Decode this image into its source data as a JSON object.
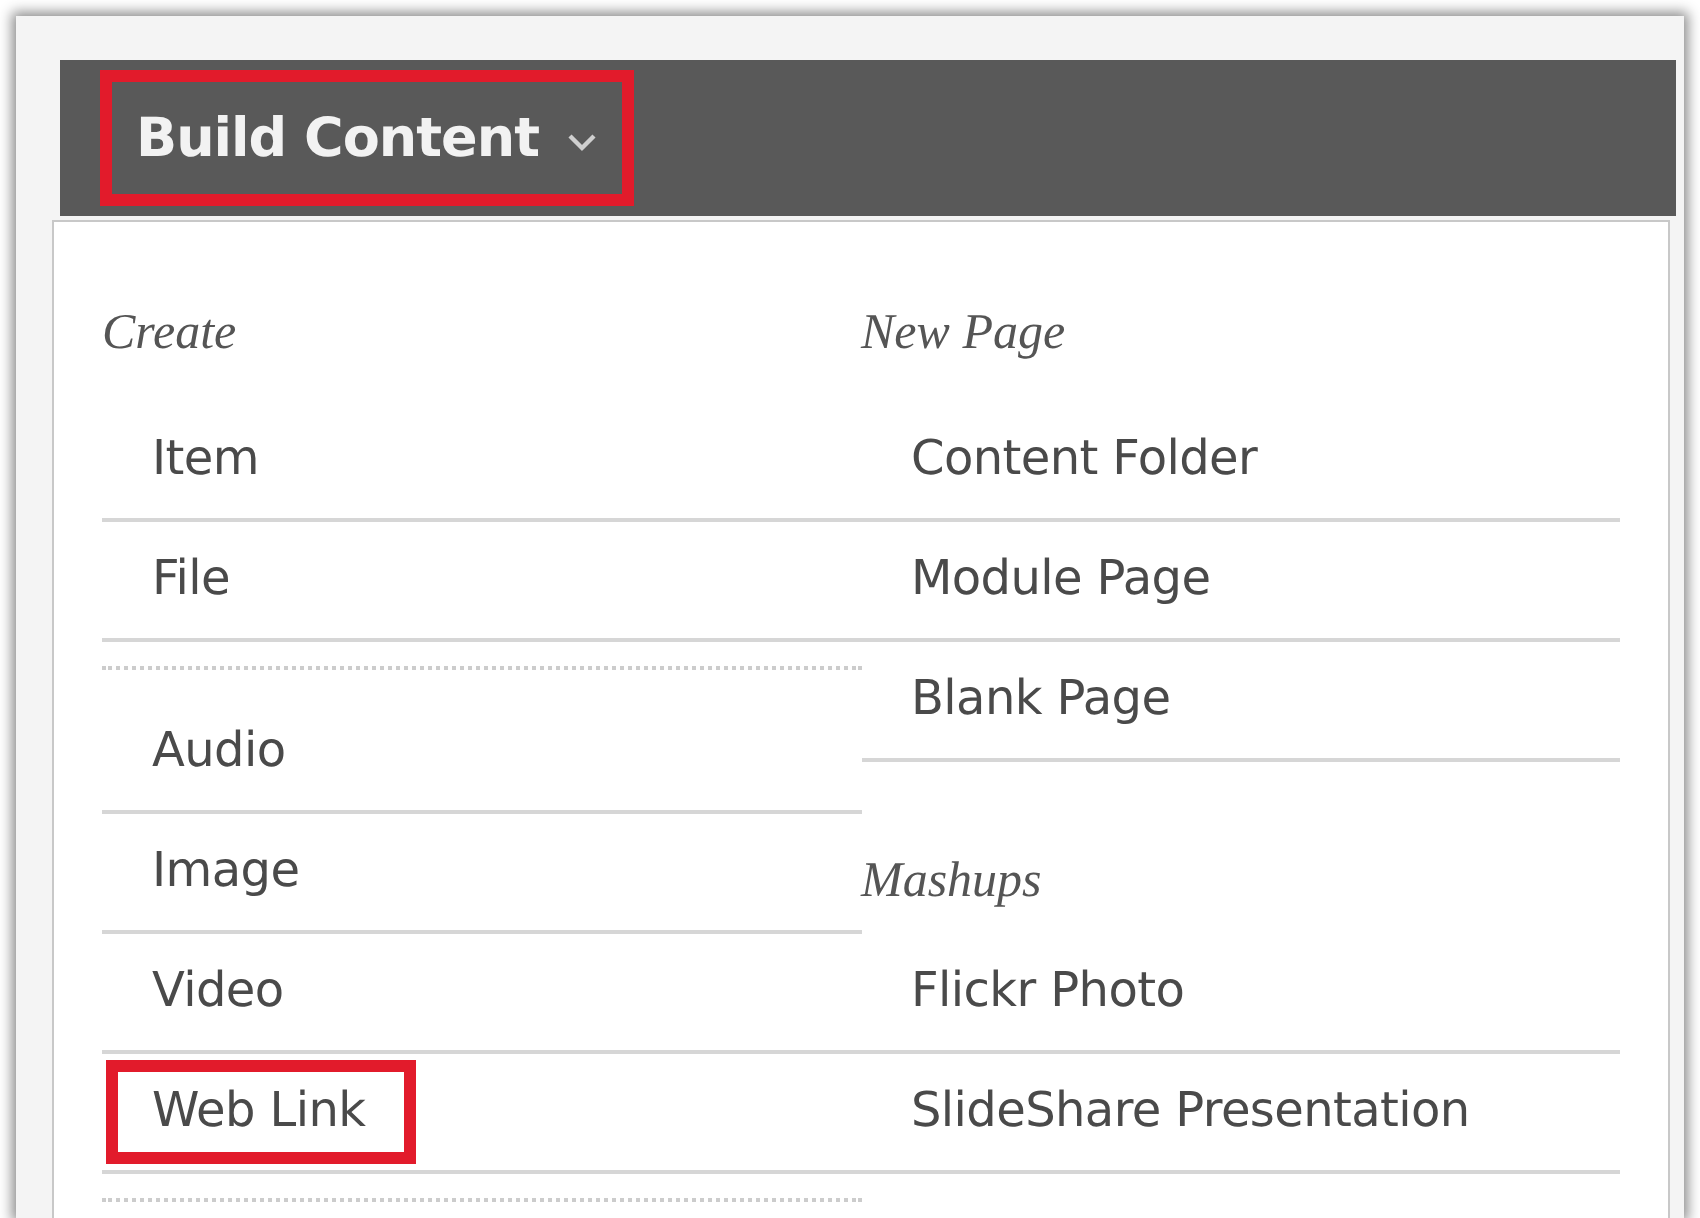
{
  "toolbar": {
    "button": {
      "label": "Build Content",
      "highlighted": true
    }
  },
  "menu": {
    "columns": [
      {
        "sections": [
          {
            "heading": "Create",
            "groups": [
              [
                {
                  "label": "Item",
                  "highlighted": false
                },
                {
                  "label": "File",
                  "highlighted": false
                }
              ],
              [
                {
                  "label": "Audio",
                  "highlighted": false
                },
                {
                  "label": "Image",
                  "highlighted": false
                },
                {
                  "label": "Video",
                  "highlighted": false
                },
                {
                  "label": "Web Link",
                  "highlighted": true
                }
              ]
            ]
          }
        ]
      },
      {
        "sections": [
          {
            "heading": "New Page",
            "groups": [
              [
                {
                  "label": "Content Folder",
                  "highlighted": false
                },
                {
                  "label": "Module Page",
                  "highlighted": false
                },
                {
                  "label": "Blank Page",
                  "highlighted": false
                }
              ]
            ]
          },
          {
            "heading": "Mashups",
            "groups": [
              [
                {
                  "label": "Flickr Photo",
                  "highlighted": false
                },
                {
                  "label": "SlideShare Presentation",
                  "highlighted": false
                }
              ]
            ]
          }
        ]
      }
    ]
  }
}
